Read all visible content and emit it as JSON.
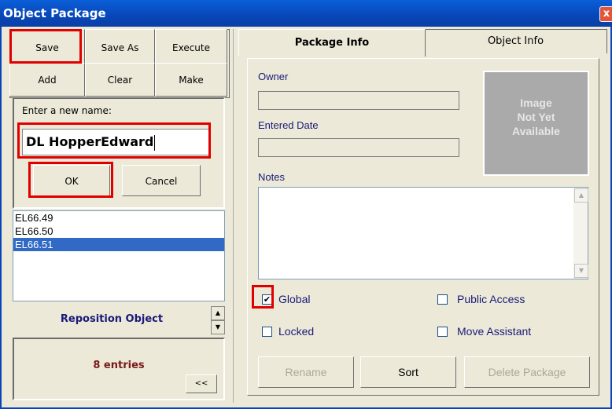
{
  "window": {
    "title": "Object Package",
    "close_glyph": "x"
  },
  "toolbar": {
    "save": "Save",
    "save_as": "Save As",
    "execute": "Execute",
    "add": "Add",
    "clear": "Clear",
    "make": "Make"
  },
  "name_dialog": {
    "label": "Enter a new name:",
    "value": "DL HopperEdward",
    "ok": "OK",
    "cancel": "Cancel"
  },
  "object_list": {
    "items": [
      "EL66.49",
      "EL66.50",
      "EL66.51"
    ],
    "selected": "EL66.51"
  },
  "reposition_label": "Reposition Object",
  "entries_label": "8 entries",
  "collapse_label": "<<",
  "tabs": {
    "package_info": "Package Info",
    "object_info": "Object Info"
  },
  "package_info": {
    "owner_label": "Owner",
    "entered_date_label": "Entered Date",
    "notes_label": "Notes",
    "image_placeholder": [
      "Image",
      "Not Yet",
      "Available"
    ],
    "checkboxes": {
      "global": {
        "label": "Global",
        "checked": true
      },
      "public_access": {
        "label": "Public Access",
        "checked": false
      },
      "locked": {
        "label": "Locked",
        "checked": false
      },
      "move_assistant": {
        "label": "Move Assistant",
        "checked": false
      }
    },
    "buttons": {
      "rename": "Rename",
      "sort": "Sort",
      "delete_package": "Delete Package"
    }
  },
  "colors": {
    "highlight": "#e00000",
    "selection": "#316ac5",
    "title_bar": "#0a5fd8"
  }
}
